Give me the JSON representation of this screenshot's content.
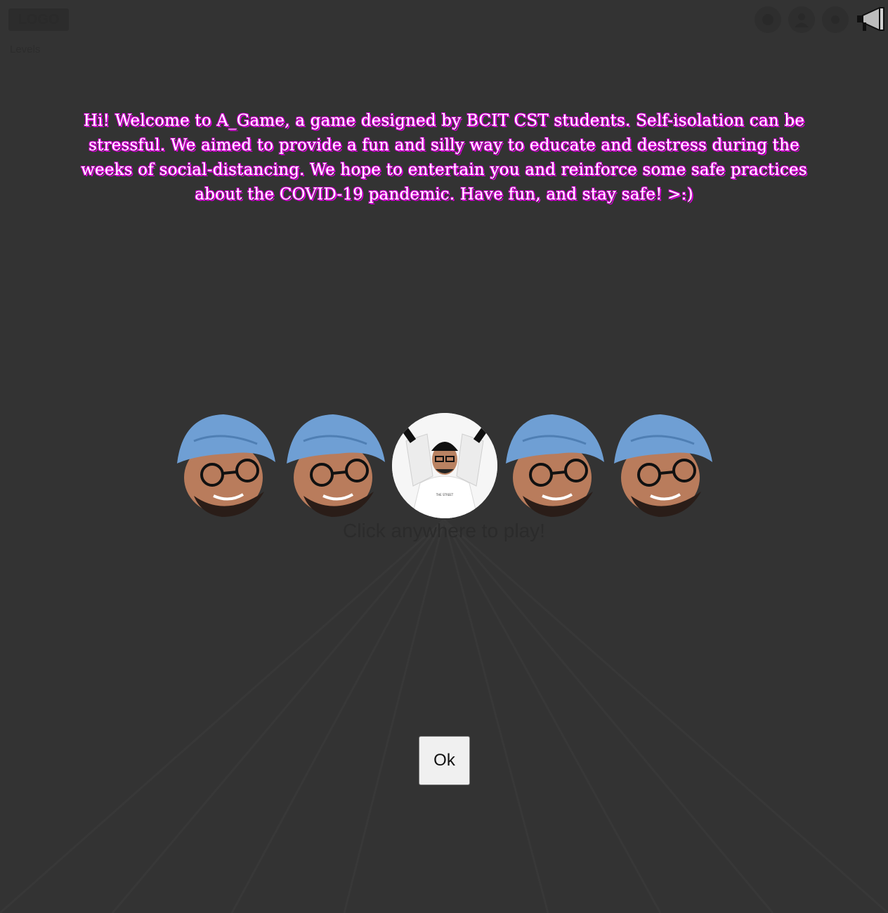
{
  "header": {
    "logo_text": "LOGO",
    "sub_label": "Levels"
  },
  "welcome": {
    "message": "Hi! Welcome to A_Game, a game designed by BCIT CST students. Self-isolation can be stressful. We aimed to provide a fun and silly way to educate and destress during the weeks of social-distancing. We hope to entertain you and reinforce some safe practices about the COVID-19 pandemic. Have fun, and stay safe! >:)"
  },
  "hint": {
    "text": "Click anywhere to play!"
  },
  "dialog": {
    "ok_label": "Ok"
  },
  "icons": [
    "info-icon",
    "profile-icon",
    "settings-icon",
    "megaphone-icon"
  ],
  "colors": {
    "background": "#333333",
    "text": "#ffffff",
    "text_shadow": "#d400d4",
    "turban": "#6f9fd4"
  }
}
